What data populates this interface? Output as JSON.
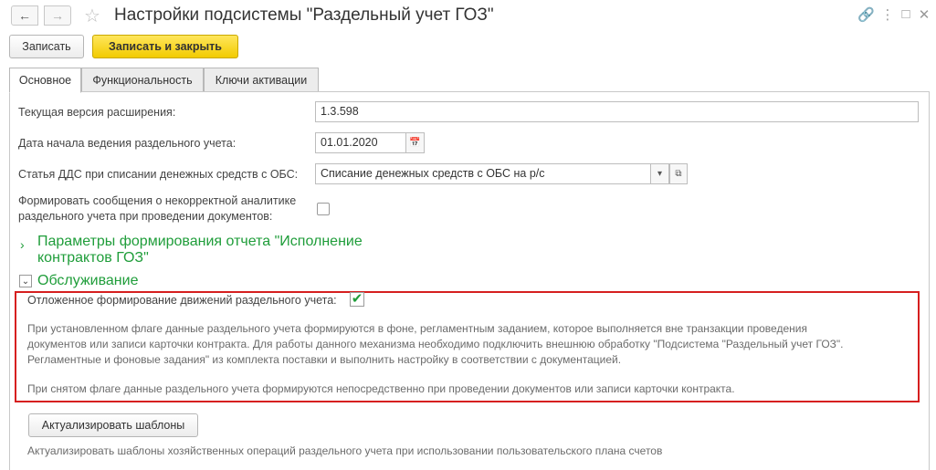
{
  "window": {
    "title": "Настройки подсистемы \"Раздельный учет ГОЗ\"",
    "nav_back_icon": "arrow-left-icon",
    "nav_forward_icon": "arrow-right-icon",
    "favorite_icon": "star-icon",
    "link_icon": "link-icon",
    "more_icon": "more-icon",
    "maximize_icon": "maximize-icon",
    "close_icon": "close-icon"
  },
  "toolbar": {
    "save_label": "Записать",
    "save_close_label": "Записать и закрыть"
  },
  "tabs": [
    {
      "label": "Основное",
      "active": true
    },
    {
      "label": "Функциональность",
      "active": false
    },
    {
      "label": "Ключи активации",
      "active": false
    }
  ],
  "form": {
    "version_label": "Текущая версия расширения:",
    "version_value": "1.3.598",
    "start_date_label": "Дата начала ведения раздельного учета:",
    "start_date_value": "01.01.2020",
    "dds_label": "Статья ДДС при списании денежных средств с ОБС:",
    "dds_value": "Списание денежных средств с ОБС на р/с",
    "messages_label_line1": "Формировать сообщения о некорректной аналитике",
    "messages_label_line2": "раздельного учета при проведении документов:",
    "messages_checked": false
  },
  "groups": {
    "report_title_line1": "Параметры формирования отчета \"Исполнение",
    "report_title_line2": "контрактов ГОЗ\"",
    "service_title": "Обслуживание"
  },
  "service": {
    "deferred_label": "Отложенное формирование движений раздельного учета:",
    "deferred_checked": true,
    "note1_line1": "При установленном флаге данные раздельного учета формируются в фоне, регламентным заданием, которое выполняется вне транзакции проведения",
    "note1_line2": "документов или записи карточки контракта. Для работы данного механизма необходимо подключить внешнюю обработку \"Подсистема \"Раздельный учет ГОЗ\".",
    "note1_line3": "Регламентные и фоновые задания\" из комплекта поставки и выполнить настройку в соответствии с документацией.",
    "note2": "При снятом флаге данные раздельного учета формируются непосредственно при проведении документов или записи карточки контракта."
  },
  "templates": {
    "button_label": "Актуализировать шаблоны",
    "description": "Актуализировать шаблоны хозяйственных операций раздельного учета при использовании пользовательского плана счетов"
  },
  "colors": {
    "group_title": "#1f9d3a",
    "highlight_border": "#d61f1f",
    "primary_button": "#f2cb00"
  }
}
